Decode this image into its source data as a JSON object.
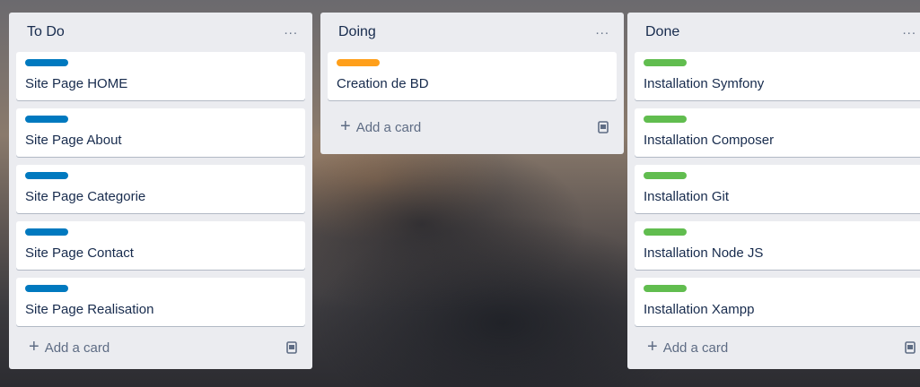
{
  "lists": [
    {
      "title": "To Do",
      "menu": "...",
      "cards": [
        {
          "title": "Site Page HOME",
          "label_color": "#0079bf"
        },
        {
          "title": "Site Page About",
          "label_color": "#0079bf"
        },
        {
          "title": "Site Page Categorie",
          "label_color": "#0079bf"
        },
        {
          "title": "Site Page Contact",
          "label_color": "#0079bf"
        },
        {
          "title": "Site Page Realisation",
          "label_color": "#0079bf"
        }
      ],
      "add_card": "Add a card",
      "add_icon": "+"
    },
    {
      "title": "Doing",
      "menu": "...",
      "cards": [
        {
          "title": "Creation de BD",
          "label_color": "#ff9f1a"
        }
      ],
      "add_card": "Add a card",
      "add_icon": "+"
    },
    {
      "title": "Done",
      "menu": "...",
      "cards": [
        {
          "title": "Installation Symfony",
          "label_color": "#61bd4f"
        },
        {
          "title": "Installation Composer",
          "label_color": "#61bd4f"
        },
        {
          "title": "Installation Git",
          "label_color": "#61bd4f"
        },
        {
          "title": "Installation Node JS",
          "label_color": "#61bd4f"
        },
        {
          "title": "Installation Xampp",
          "label_color": "#61bd4f"
        }
      ],
      "add_card": "Add a card",
      "add_icon": "+"
    }
  ],
  "icons": {
    "menu": "more-icon",
    "add": "plus-icon",
    "template": "card-template-icon"
  }
}
